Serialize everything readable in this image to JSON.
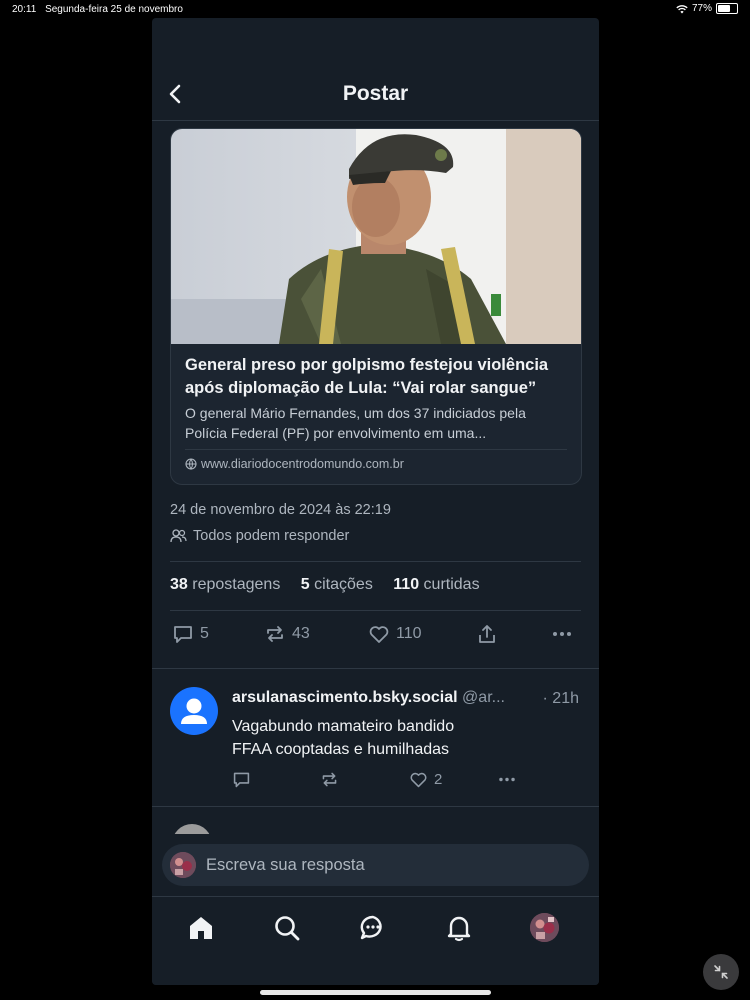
{
  "status_bar": {
    "time": "20:11",
    "date": "Segunda-feira 25 de novembro",
    "battery_percent": "77%",
    "battery_level": 0.77
  },
  "header": {
    "title": "Postar",
    "back_icon": "chevron-left-icon"
  },
  "link_card": {
    "title": "General preso por golpismo festejou violência após diplomação de Lula: “Vai rolar sangue”",
    "description": "O general Mário Fernandes, um dos 37 indiciados pela Polícia Federal (PF) por envolvimento em uma...",
    "domain": "www.diariodocentrodomundo.com.br",
    "domain_icon": "globe-icon"
  },
  "post": {
    "datetime": "24 de novembro de 2024 às 22:19",
    "reply_permission": "Todos podem responder",
    "reply_permission_icon": "people-icon",
    "stats": {
      "reposts_count": "38",
      "reposts_label": "repostagens",
      "quotes_count": "5",
      "quotes_label": "citações",
      "likes_count": "110",
      "likes_label": "curtidas"
    },
    "actions": {
      "reply_count": "5",
      "repost_count": "43",
      "like_count": "110"
    }
  },
  "reply": {
    "author": "arsulanascimento.bsky.social",
    "handle": "@ar...",
    "time": "· 21h",
    "text_line1": "Vagabundo mamateiro bandido",
    "text_line2": "FFAA cooptadas e humilhadas",
    "like_count": "2"
  },
  "compose": {
    "placeholder": "Escreva sua resposta"
  },
  "tabs": [
    "home-icon",
    "search-icon",
    "chat-icon",
    "bell-icon",
    "profile-avatar"
  ],
  "colors": {
    "background": "#161e27",
    "border": "#2e3843",
    "text_muted": "#aeb6bf",
    "icon_muted": "#8f9aa6",
    "default_avatar": "#1a73ff"
  }
}
